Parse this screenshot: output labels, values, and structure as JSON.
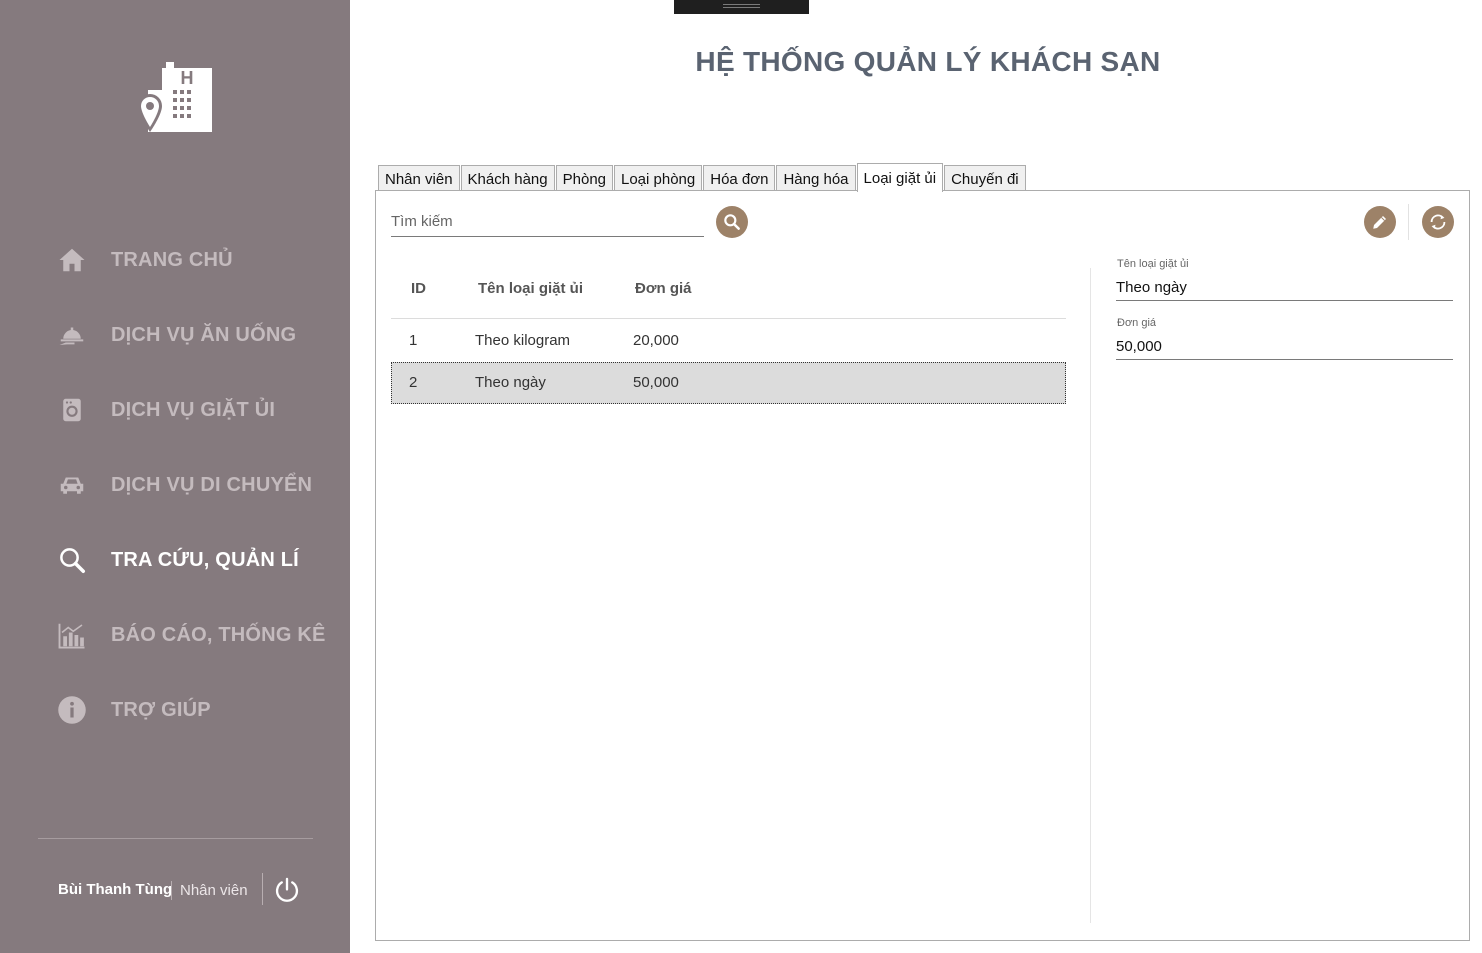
{
  "app": {
    "title": "HỆ THỐNG QUẢN LÝ KHÁCH SẠN"
  },
  "sidebar": {
    "items": [
      {
        "label": "TRANG CHỦ",
        "icon": "home-icon",
        "active": false
      },
      {
        "label": "DỊCH VỤ ĂN UỐNG",
        "icon": "room-service-icon",
        "active": false
      },
      {
        "label": "DỊCH VỤ GIẶT ỦI",
        "icon": "washing-machine-icon",
        "active": false
      },
      {
        "label": "DỊCH VỤ DI CHUYỂN",
        "icon": "car-icon",
        "active": false
      },
      {
        "label": "TRA CỨU, QUẢN LÍ",
        "icon": "search-icon",
        "active": true
      },
      {
        "label": "BÁO CÁO, THỐNG KÊ",
        "icon": "chart-icon",
        "active": false
      },
      {
        "label": "TRỢ GIÚP",
        "icon": "info-icon",
        "active": false
      }
    ],
    "user": {
      "name": "Bùi Thanh Tùng",
      "role": "Nhân viên"
    }
  },
  "tabs": [
    {
      "label": "Nhân viên",
      "active": false
    },
    {
      "label": "Khách hàng",
      "active": false
    },
    {
      "label": "Phòng",
      "active": false
    },
    {
      "label": "Loại phòng",
      "active": false
    },
    {
      "label": "Hóa đơn",
      "active": false
    },
    {
      "label": "Hàng hóa",
      "active": false
    },
    {
      "label": "Loại giặt ủi",
      "active": true
    },
    {
      "label": "Chuyến đi",
      "active": false
    }
  ],
  "search": {
    "placeholder": "Tìm kiếm",
    "value": ""
  },
  "table": {
    "columns": [
      "ID",
      "Tên loại giặt ủi",
      "Đơn giá"
    ],
    "rows": [
      {
        "id": "1",
        "name": "Theo kilogram",
        "price": "20,000",
        "selected": false
      },
      {
        "id": "2",
        "name": "Theo ngày",
        "price": "50,000",
        "selected": true
      }
    ]
  },
  "detail": {
    "name_label": "Tên loại giặt ủi",
    "name_value": "Theo ngày",
    "price_label": "Đơn giá",
    "price_value": "50,000"
  },
  "colors": {
    "sidebar": "#857a7e",
    "accent": "#9d8268",
    "title": "#5a6371"
  }
}
